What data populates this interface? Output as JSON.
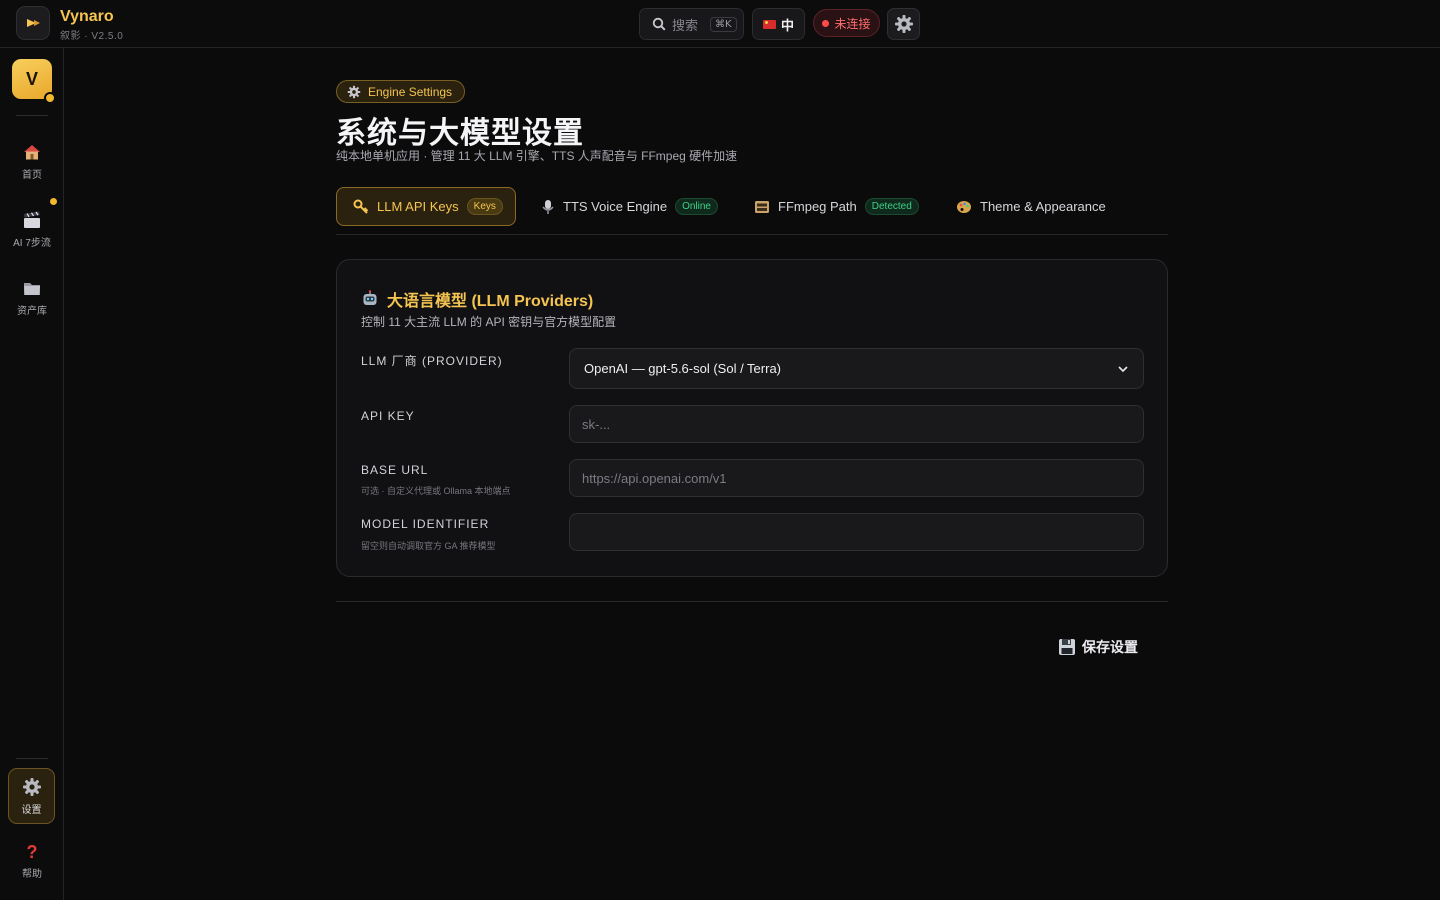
{
  "app": {
    "name": "Vynaro",
    "subtitle": "叙影 · V2.5.0"
  },
  "topbar": {
    "search_label": "搜索",
    "search_shortcut": "⌘K",
    "language": "中",
    "status": "未连接"
  },
  "sidebar": {
    "avatar_letter": "V",
    "items": [
      {
        "label": "首页"
      },
      {
        "label": "AI 7步流"
      },
      {
        "label": "资产库"
      }
    ],
    "settings_label": "设置",
    "help_label": "帮助"
  },
  "page": {
    "badge": "Engine Settings",
    "title": "系统与大模型设置",
    "subtitle": "纯本地单机应用 · 管理 11 大 LLM 引擎、TTS 人声配音与 FFmpeg 硬件加速"
  },
  "tabs": [
    {
      "label": "LLM API Keys",
      "pill": "Keys"
    },
    {
      "label": "TTS Voice Engine",
      "pill": "Online"
    },
    {
      "label": "FFmpeg Path",
      "pill": "Detected"
    },
    {
      "label": "Theme & Appearance"
    }
  ],
  "llm_card": {
    "title": "大语言模型 (LLM Providers)",
    "subtitle": "控制 11 大主流 LLM 的 API 密钥与官方模型配置",
    "provider": {
      "label": "LLM 厂商 (PROVIDER)",
      "value": "OpenAI — gpt-5.6-sol (Sol / Terra)"
    },
    "api_key": {
      "label": "API KEY",
      "placeholder": "sk-..."
    },
    "base_url": {
      "label": "BASE URL",
      "hint": "可选 · 自定义代理或 Ollama 本地端点",
      "placeholder": "https://api.openai.com/v1"
    },
    "model_id": {
      "label": "MODEL IDENTIFIER",
      "hint": "留空则自动调取官方 GA 推荐模型",
      "value": ""
    }
  },
  "actions": {
    "save_label": "保存设置"
  },
  "colors": {
    "accent": "#f5c451",
    "background": "#0b0b0c",
    "status_error": "#ff4b4b",
    "status_ok": "#3fd088"
  }
}
